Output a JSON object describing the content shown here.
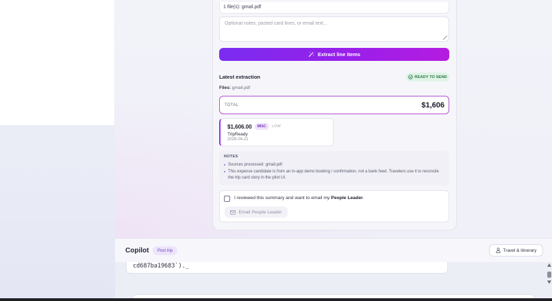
{
  "upload": {
    "file_count_text": "1 file(s): gmail.pdf",
    "notes_placeholder": "Optional notes, pasted card lines, or email text..."
  },
  "extract_button": {
    "label": "Extract line items",
    "icon": "magic-wand-icon"
  },
  "extraction": {
    "title": "Latest extraction",
    "status_badge": "READY TO SEND",
    "status_color": "#2f7a4a",
    "files_label": "Files:",
    "files_value": "gmail.pdf",
    "total_label": "TOTAL",
    "total_value": "$1,606",
    "line_items": [
      {
        "amount": "$1,606.00",
        "category": "MISC",
        "confidence": "LOW",
        "vendor": "TripReady",
        "date": "2026-04-21"
      }
    ],
    "notes_title": "NOTES",
    "notes": [
      "Sources processed: gmail.pdf",
      "This expense candidate is from an in-app demo booking / confirmation, not a bank feed. Travelers use it to reconcile the trip card story in the pilot UI."
    ]
  },
  "confirm": {
    "text_prefix": "I reviewed this summary and want to email my ",
    "text_bold": "People Leader",
    "text_suffix": ".",
    "email_button": "Email People Leader"
  },
  "copilot": {
    "title": "Copilot",
    "phase": "Post trip",
    "travel_button": "Travel & itinerary",
    "chat_snippet": "cd687ba19683`)._"
  },
  "colors": {
    "accent_start": "#7a2cf0",
    "accent_end": "#b51ce0",
    "total_border": "#b44fd1"
  }
}
